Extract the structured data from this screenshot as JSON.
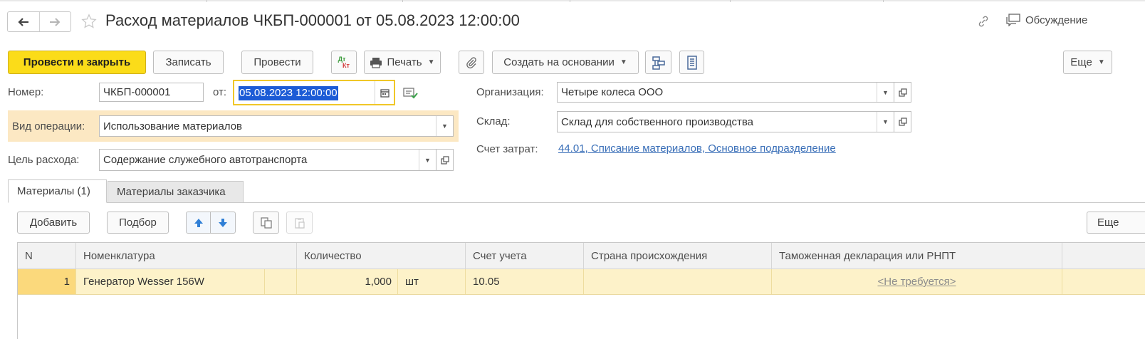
{
  "window": {
    "title": "Расход материалов ЧКБП-000001 от 05.08.2023 12:00:00",
    "discussion_label": "Обсуждение"
  },
  "toolbar": {
    "post_and_close": "Провести и закрыть",
    "save": "Записать",
    "post": "Провести",
    "dtkt_top": "Дт",
    "dtkt_bottom": "Кт",
    "print": "Печать",
    "create_based_on": "Создать на основании",
    "more": "Еще"
  },
  "form": {
    "number_label": "Номер:",
    "number_value": "ЧКБП-000001",
    "from_label": "от:",
    "date_value": "05.08.2023 12:00:00",
    "operation_label": "Вид операции:",
    "operation_value": "Использование материалов",
    "purpose_label": "Цель расхода:",
    "purpose_value": "Содержание служебного автотранспорта",
    "organization_label": "Организация:",
    "organization_value": "Четыре колеса ООО",
    "warehouse_label": "Склад:",
    "warehouse_value": "Склад для собственного производства",
    "cost_account_label": "Счет затрат:",
    "cost_account_value": "44.01, Списание материалов, Основное подразделение"
  },
  "tabs": [
    {
      "label": "Материалы (1)",
      "active": true
    },
    {
      "label": "Материалы заказчика",
      "active": false
    }
  ],
  "table_toolbar": {
    "add": "Добавить",
    "pick": "Подбор",
    "more": "Еще"
  },
  "table": {
    "columns": [
      "N",
      "Номенклатура",
      "Количество",
      "Счет учета",
      "Страна происхождения",
      "Таможенная декларация или РНПТ"
    ],
    "rows": [
      {
        "n": "1",
        "item": "Генератор Wesser 156W",
        "quantity": "1,000",
        "unit": "шт",
        "account": "10.05",
        "country": "",
        "customs": "<Не требуется>"
      }
    ]
  },
  "colors": {
    "primary_button": "#fbdc19",
    "highlight_band": "#fce8c3",
    "selected_row": "#fdf2c9",
    "link": "#3a6fb8",
    "date_focus_border": "#f0c728"
  }
}
